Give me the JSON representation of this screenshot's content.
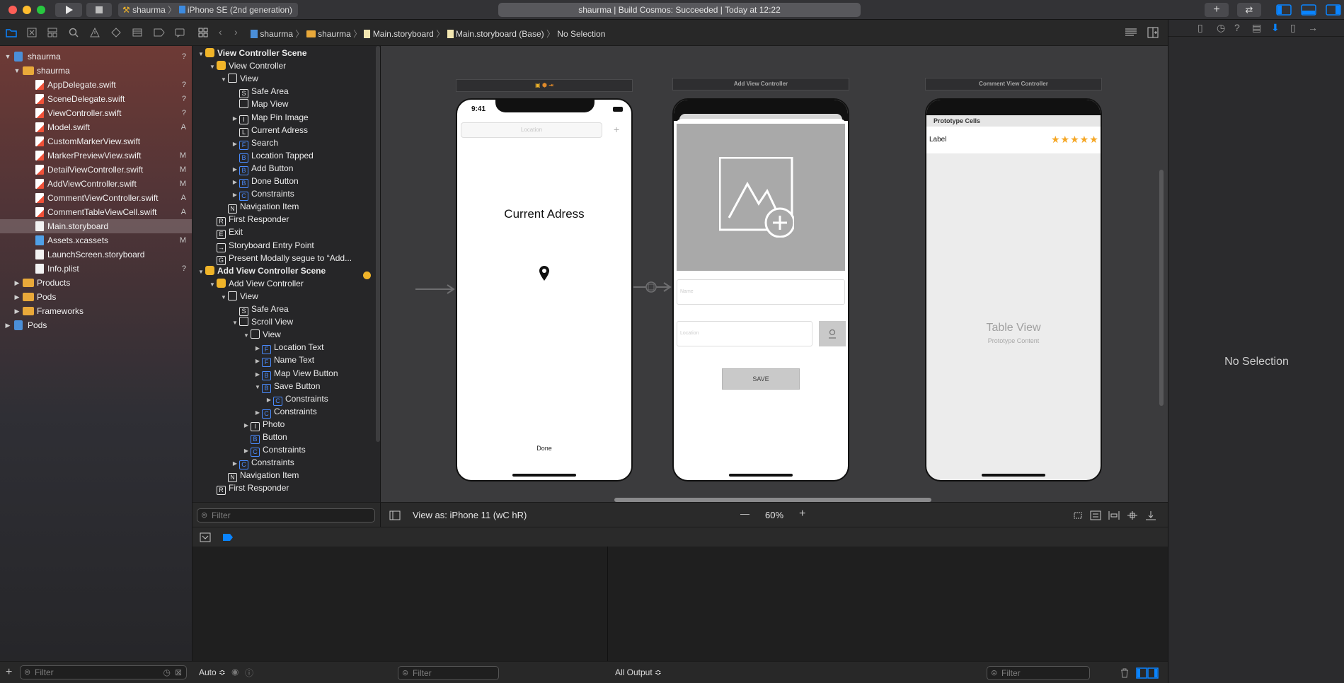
{
  "toolbar": {
    "scheme_project": "shaurma",
    "scheme_device": "iPhone SE (2nd generation)",
    "status": "shaurma | Build Cosmos: Succeeded | Today at 12:22",
    "colors": {
      "close": "#fe5f57",
      "minimize": "#febc2e",
      "zoom": "#28c840",
      "accent": "#0a84ff"
    }
  },
  "navigator": {
    "tab_icons": [
      "folder-icon",
      "x-square-icon",
      "hierarchy-icon",
      "search-icon",
      "warning-icon",
      "test-diamond-icon",
      "debug-icon",
      "breakpoint-icon",
      "report-icon"
    ],
    "items": [
      {
        "label": "shaurma",
        "kind": "project",
        "level": 0,
        "open": true,
        "badge": "?"
      },
      {
        "label": "shaurma",
        "kind": "folder",
        "level": 1,
        "open": true,
        "badge": ""
      },
      {
        "label": "AppDelegate.swift",
        "kind": "swift",
        "level": 2,
        "badge": "?"
      },
      {
        "label": "SceneDelegate.swift",
        "kind": "swift",
        "level": 2,
        "badge": "?"
      },
      {
        "label": "ViewController.swift",
        "kind": "swift",
        "level": 2,
        "badge": "?"
      },
      {
        "label": "Model.swift",
        "kind": "swift",
        "level": 2,
        "badge": "A"
      },
      {
        "label": "CustomMarkerView.swift",
        "kind": "swift",
        "level": 2,
        "badge": ""
      },
      {
        "label": "MarkerPreviewView.swift",
        "kind": "swift",
        "level": 2,
        "badge": "M"
      },
      {
        "label": "DetailViewController.swift",
        "kind": "swift",
        "level": 2,
        "badge": "M"
      },
      {
        "label": "AddViewController.swift",
        "kind": "swift",
        "level": 2,
        "badge": "M"
      },
      {
        "label": "CommentViewController.swift",
        "kind": "swift",
        "level": 2,
        "badge": "A"
      },
      {
        "label": "CommentTableViewCell.swift",
        "kind": "swift",
        "level": 2,
        "badge": "A"
      },
      {
        "label": "Main.storyboard",
        "kind": "file",
        "level": 2,
        "badge": "",
        "selected": true
      },
      {
        "label": "Assets.xcassets",
        "kind": "assets",
        "level": 2,
        "badge": "M"
      },
      {
        "label": "LaunchScreen.storyboard",
        "kind": "file",
        "level": 2,
        "badge": ""
      },
      {
        "label": "Info.plist",
        "kind": "file",
        "level": 2,
        "badge": "?"
      },
      {
        "label": "Products",
        "kind": "folder",
        "level": 1,
        "open": false,
        "badge": ""
      },
      {
        "label": "Pods",
        "kind": "folder",
        "level": 1,
        "open": false,
        "badge": ""
      },
      {
        "label": "Frameworks",
        "kind": "folder",
        "level": 1,
        "open": false,
        "badge": ""
      },
      {
        "label": "Pods",
        "kind": "project",
        "level": 0,
        "open": false,
        "badge": ""
      }
    ],
    "filter_placeholder": "Filter"
  },
  "jumpbar": {
    "crumbs": [
      "shaurma",
      "shaurma",
      "Main.storyboard",
      "Main.storyboard (Base)",
      "No Selection"
    ]
  },
  "outline": {
    "rows": [
      {
        "label": "View Controller Scene",
        "level": 0,
        "disc": "open",
        "icon": "Y",
        "bold": true
      },
      {
        "label": "View Controller",
        "level": 1,
        "disc": "open",
        "icon": "Y"
      },
      {
        "label": "View",
        "level": 2,
        "disc": "open",
        "icon": "W"
      },
      {
        "label": "Safe Area",
        "level": 3,
        "disc": "",
        "icon": "S"
      },
      {
        "label": "Map View",
        "level": 3,
        "disc": "",
        "icon": "W"
      },
      {
        "label": "Map Pin Image",
        "level": 3,
        "disc": "closed",
        "icon": "I"
      },
      {
        "label": "Current Adress",
        "level": 3,
        "disc": "",
        "icon": "L"
      },
      {
        "label": "Search",
        "level": 3,
        "disc": "closed",
        "icon": "F"
      },
      {
        "label": "Location Tapped",
        "level": 3,
        "disc": "",
        "icon": "B"
      },
      {
        "label": "Add Button",
        "level": 3,
        "disc": "closed",
        "icon": "B"
      },
      {
        "label": "Done Button",
        "level": 3,
        "disc": "closed",
        "icon": "B"
      },
      {
        "label": "Constraints",
        "level": 3,
        "disc": "closed",
        "icon": "C"
      },
      {
        "label": "Navigation Item",
        "level": 2,
        "disc": "",
        "icon": "N"
      },
      {
        "label": "First Responder",
        "level": 1,
        "disc": "",
        "icon": "R"
      },
      {
        "label": "Exit",
        "level": 1,
        "disc": "",
        "icon": "E"
      },
      {
        "label": "Storyboard Entry Point",
        "level": 1,
        "disc": "",
        "icon": "→"
      },
      {
        "label": "Present Modally segue to “Add...",
        "level": 1,
        "disc": "",
        "icon": "G"
      },
      {
        "label": "Add View Controller Scene",
        "level": 0,
        "disc": "open",
        "icon": "Y",
        "bold": true
      },
      {
        "label": "Add View Controller",
        "level": 1,
        "disc": "open",
        "icon": "Y"
      },
      {
        "label": "View",
        "level": 2,
        "disc": "open",
        "icon": "W"
      },
      {
        "label": "Safe Area",
        "level": 3,
        "disc": "",
        "icon": "S"
      },
      {
        "label": "Scroll View",
        "level": 3,
        "disc": "open",
        "icon": "W"
      },
      {
        "label": "View",
        "level": 4,
        "disc": "open",
        "icon": "W"
      },
      {
        "label": "Location Text",
        "level": 5,
        "disc": "closed",
        "icon": "F"
      },
      {
        "label": "Name Text",
        "level": 5,
        "disc": "closed",
        "icon": "F"
      },
      {
        "label": "Map View Button",
        "level": 5,
        "disc": "closed",
        "icon": "B"
      },
      {
        "label": "Save Button",
        "level": 5,
        "disc": "open",
        "icon": "B"
      },
      {
        "label": "Constraints",
        "level": 6,
        "disc": "closed",
        "icon": "C"
      },
      {
        "label": "Constraints",
        "level": 5,
        "disc": "closed",
        "icon": "C"
      },
      {
        "label": "Photo",
        "level": 4,
        "disc": "closed",
        "icon": "I"
      },
      {
        "label": "Button",
        "level": 4,
        "disc": "",
        "icon": "B"
      },
      {
        "label": "Constraints",
        "level": 4,
        "disc": "closed",
        "icon": "C"
      },
      {
        "label": "Constraints",
        "level": 3,
        "disc": "closed",
        "icon": "C"
      },
      {
        "label": "Navigation Item",
        "level": 2,
        "disc": "",
        "icon": "N"
      },
      {
        "label": "First Responder",
        "level": 1,
        "disc": "",
        "icon": "R"
      }
    ],
    "filter_placeholder": "Filter"
  },
  "canvas": {
    "vc1": {
      "time": "9:41",
      "search_placeholder": "Location",
      "plus": "+",
      "title": "Current Adress",
      "done": "Done"
    },
    "vc2": {
      "header": "Add View Controller",
      "name_placeholder": "Name",
      "location_placeholder": "Location",
      "save": "SAVE"
    },
    "vc3": {
      "header": "Comment View Controller",
      "prototype_cells": "Prototype Cells",
      "label": "Label",
      "stars": "★★★★★",
      "table_view": "Table View",
      "prototype_content": "Prototype Content"
    },
    "view_as": "View as: iPhone 11 (wC hR)",
    "zoom": "60%",
    "zoom_minus": "—",
    "zoom_plus": "+"
  },
  "debug": {
    "auto": "Auto ≎",
    "output": "All Output ≎",
    "filter_placeholder": "Filter"
  },
  "inspector": {
    "no_selection": "No Selection"
  }
}
